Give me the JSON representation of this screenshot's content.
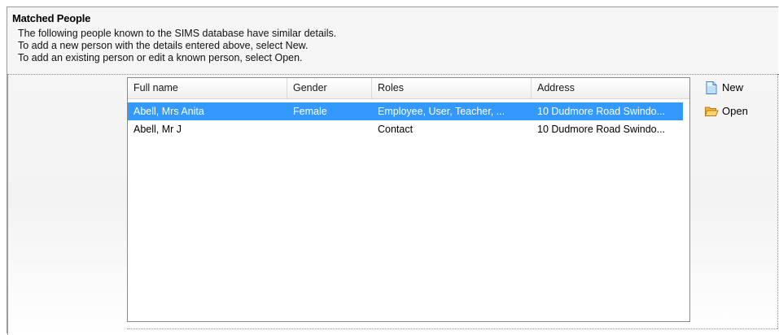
{
  "section": {
    "title": "Matched People",
    "description": [
      "The following people known to the SIMS database have similar details.",
      "To add a new person with the details entered above, select New.",
      "To add an existing person or edit a known person, select Open."
    ]
  },
  "grid": {
    "columns": [
      "Full name",
      "Gender",
      "Roles",
      "Address"
    ],
    "rows": [
      {
        "name": "Abell, Mrs Anita",
        "gender": "Female",
        "roles": "Employee, User, Teacher, ...",
        "address": "10 Dudmore Road Swindo...",
        "selected": true
      },
      {
        "name": "Abell, Mr J",
        "gender": "",
        "roles": "Contact",
        "address": "10 Dudmore Road Swindo...",
        "selected": false
      }
    ]
  },
  "actions": {
    "new_label": "New",
    "open_label": "Open"
  },
  "icons": {
    "new": "new-document-icon",
    "open": "open-folder-icon"
  },
  "colors": {
    "selection": "#3399ff"
  }
}
